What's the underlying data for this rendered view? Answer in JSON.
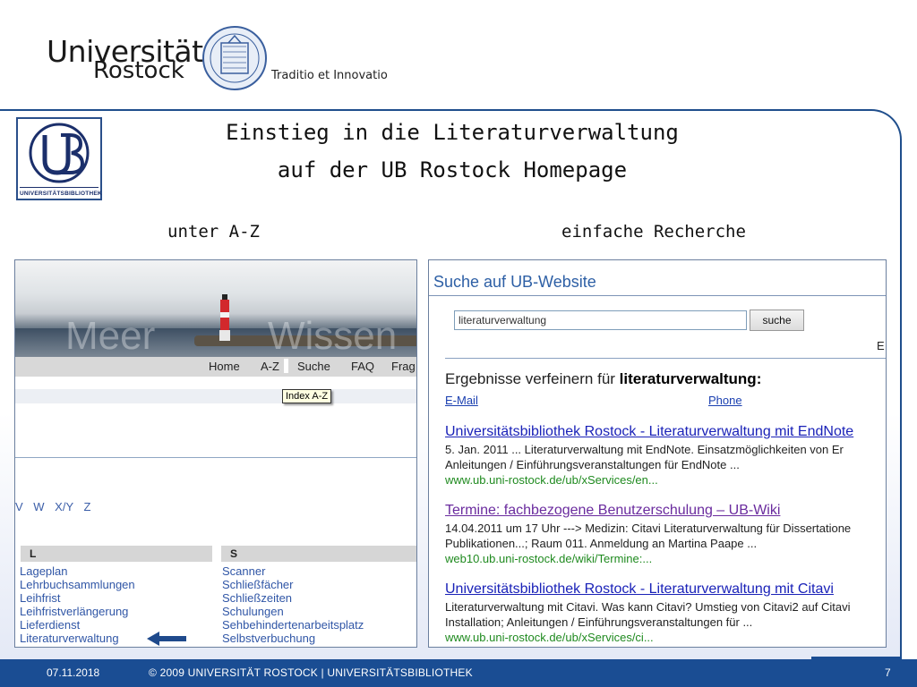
{
  "header": {
    "university_line1": "Universität",
    "university_line2": "Rostock",
    "motto": "Traditio et Innovatio"
  },
  "ub_logo": {
    "label": "UNIVERSITÄTSBIBLIOTHEK"
  },
  "slide": {
    "title_line1": "Einstieg in die Literaturverwaltung",
    "title_line2": "auf der UB Rostock Homepage",
    "left_label": "unter A-Z",
    "right_label": "einfache Recherche"
  },
  "left_screenshot": {
    "banner_words": [
      "Meer",
      "Wissen"
    ],
    "nav": [
      "Home",
      "A-Z",
      "Suche",
      "FAQ",
      "Frag"
    ],
    "tooltip": "Index A-Z",
    "alphabet": "V  W  X/Y  Z",
    "col_l": {
      "header": "L",
      "items": [
        "Lageplan",
        "Lehrbuchsammlungen",
        "Leihfrist",
        "Leihfristverlängerung",
        "Lieferdienst",
        "Literaturverwaltung"
      ]
    },
    "col_s": {
      "header": "S",
      "items": [
        "Scanner",
        "Schließfächer",
        "Schließzeiten",
        "Schulungen",
        "Sehbehindertenarbeitsplatz",
        "Selbstverbuchung"
      ]
    }
  },
  "right_screenshot": {
    "title": "Suche auf UB-Website",
    "search_value": "literaturverwaltung",
    "search_button": "suche",
    "clipped_letter": "E",
    "refine_prefix": "Ergebnisse verfeinern für ",
    "refine_term": "literaturverwaltung:",
    "refine_links": [
      "E-Mail",
      "Phone"
    ],
    "results": [
      {
        "title": "Universitätsbibliothek Rostock - Literaturverwaltung mit EndNote",
        "snippet1": "5. Jan. 2011 ... Literaturverwaltung mit EndNote. Einsatzmöglichkeiten von Er",
        "snippet2": "Anleitungen / Einführungsveranstaltungen für EndNote ...",
        "url": "www.ub.uni-rostock.de/ub/xServices/en..."
      },
      {
        "title": "Termine: fachbezogene Benutzerschulung – UB-Wiki",
        "snippet1": "14.04.2011 um 17 Uhr ---> Medizin: Citavi Literaturverwaltung für Dissertatione",
        "snippet2": "Publikationen...; Raum 011. Anmeldung an Martina Paape ...",
        "url": "web10.ub.uni-rostock.de/wiki/Termine:..."
      },
      {
        "title": "Universitätsbibliothek Rostock - Literaturverwaltung mit Citavi",
        "snippet1": "Literaturverwaltung mit Citavi. Was kann Citavi? Umstieg von Citavi2 auf Citavi",
        "snippet2": "Installation; Anleitungen / Einführungsveranstaltungen für ...",
        "url": "www.ub.uni-rostock.de/ub/xServices/ci..."
      }
    ]
  },
  "footer": {
    "date": "07.11.2018",
    "copyright": "©  2009  UNIVERSITÄT ROSTOCK | UNIVERSITÄTSBIBLIOTHEK",
    "page": "7"
  },
  "colors": {
    "brand_blue": "#1a4d93",
    "link_blue": "#1a22b8",
    "url_green": "#1f8a1f",
    "visited_purple": "#6a2b9e"
  }
}
